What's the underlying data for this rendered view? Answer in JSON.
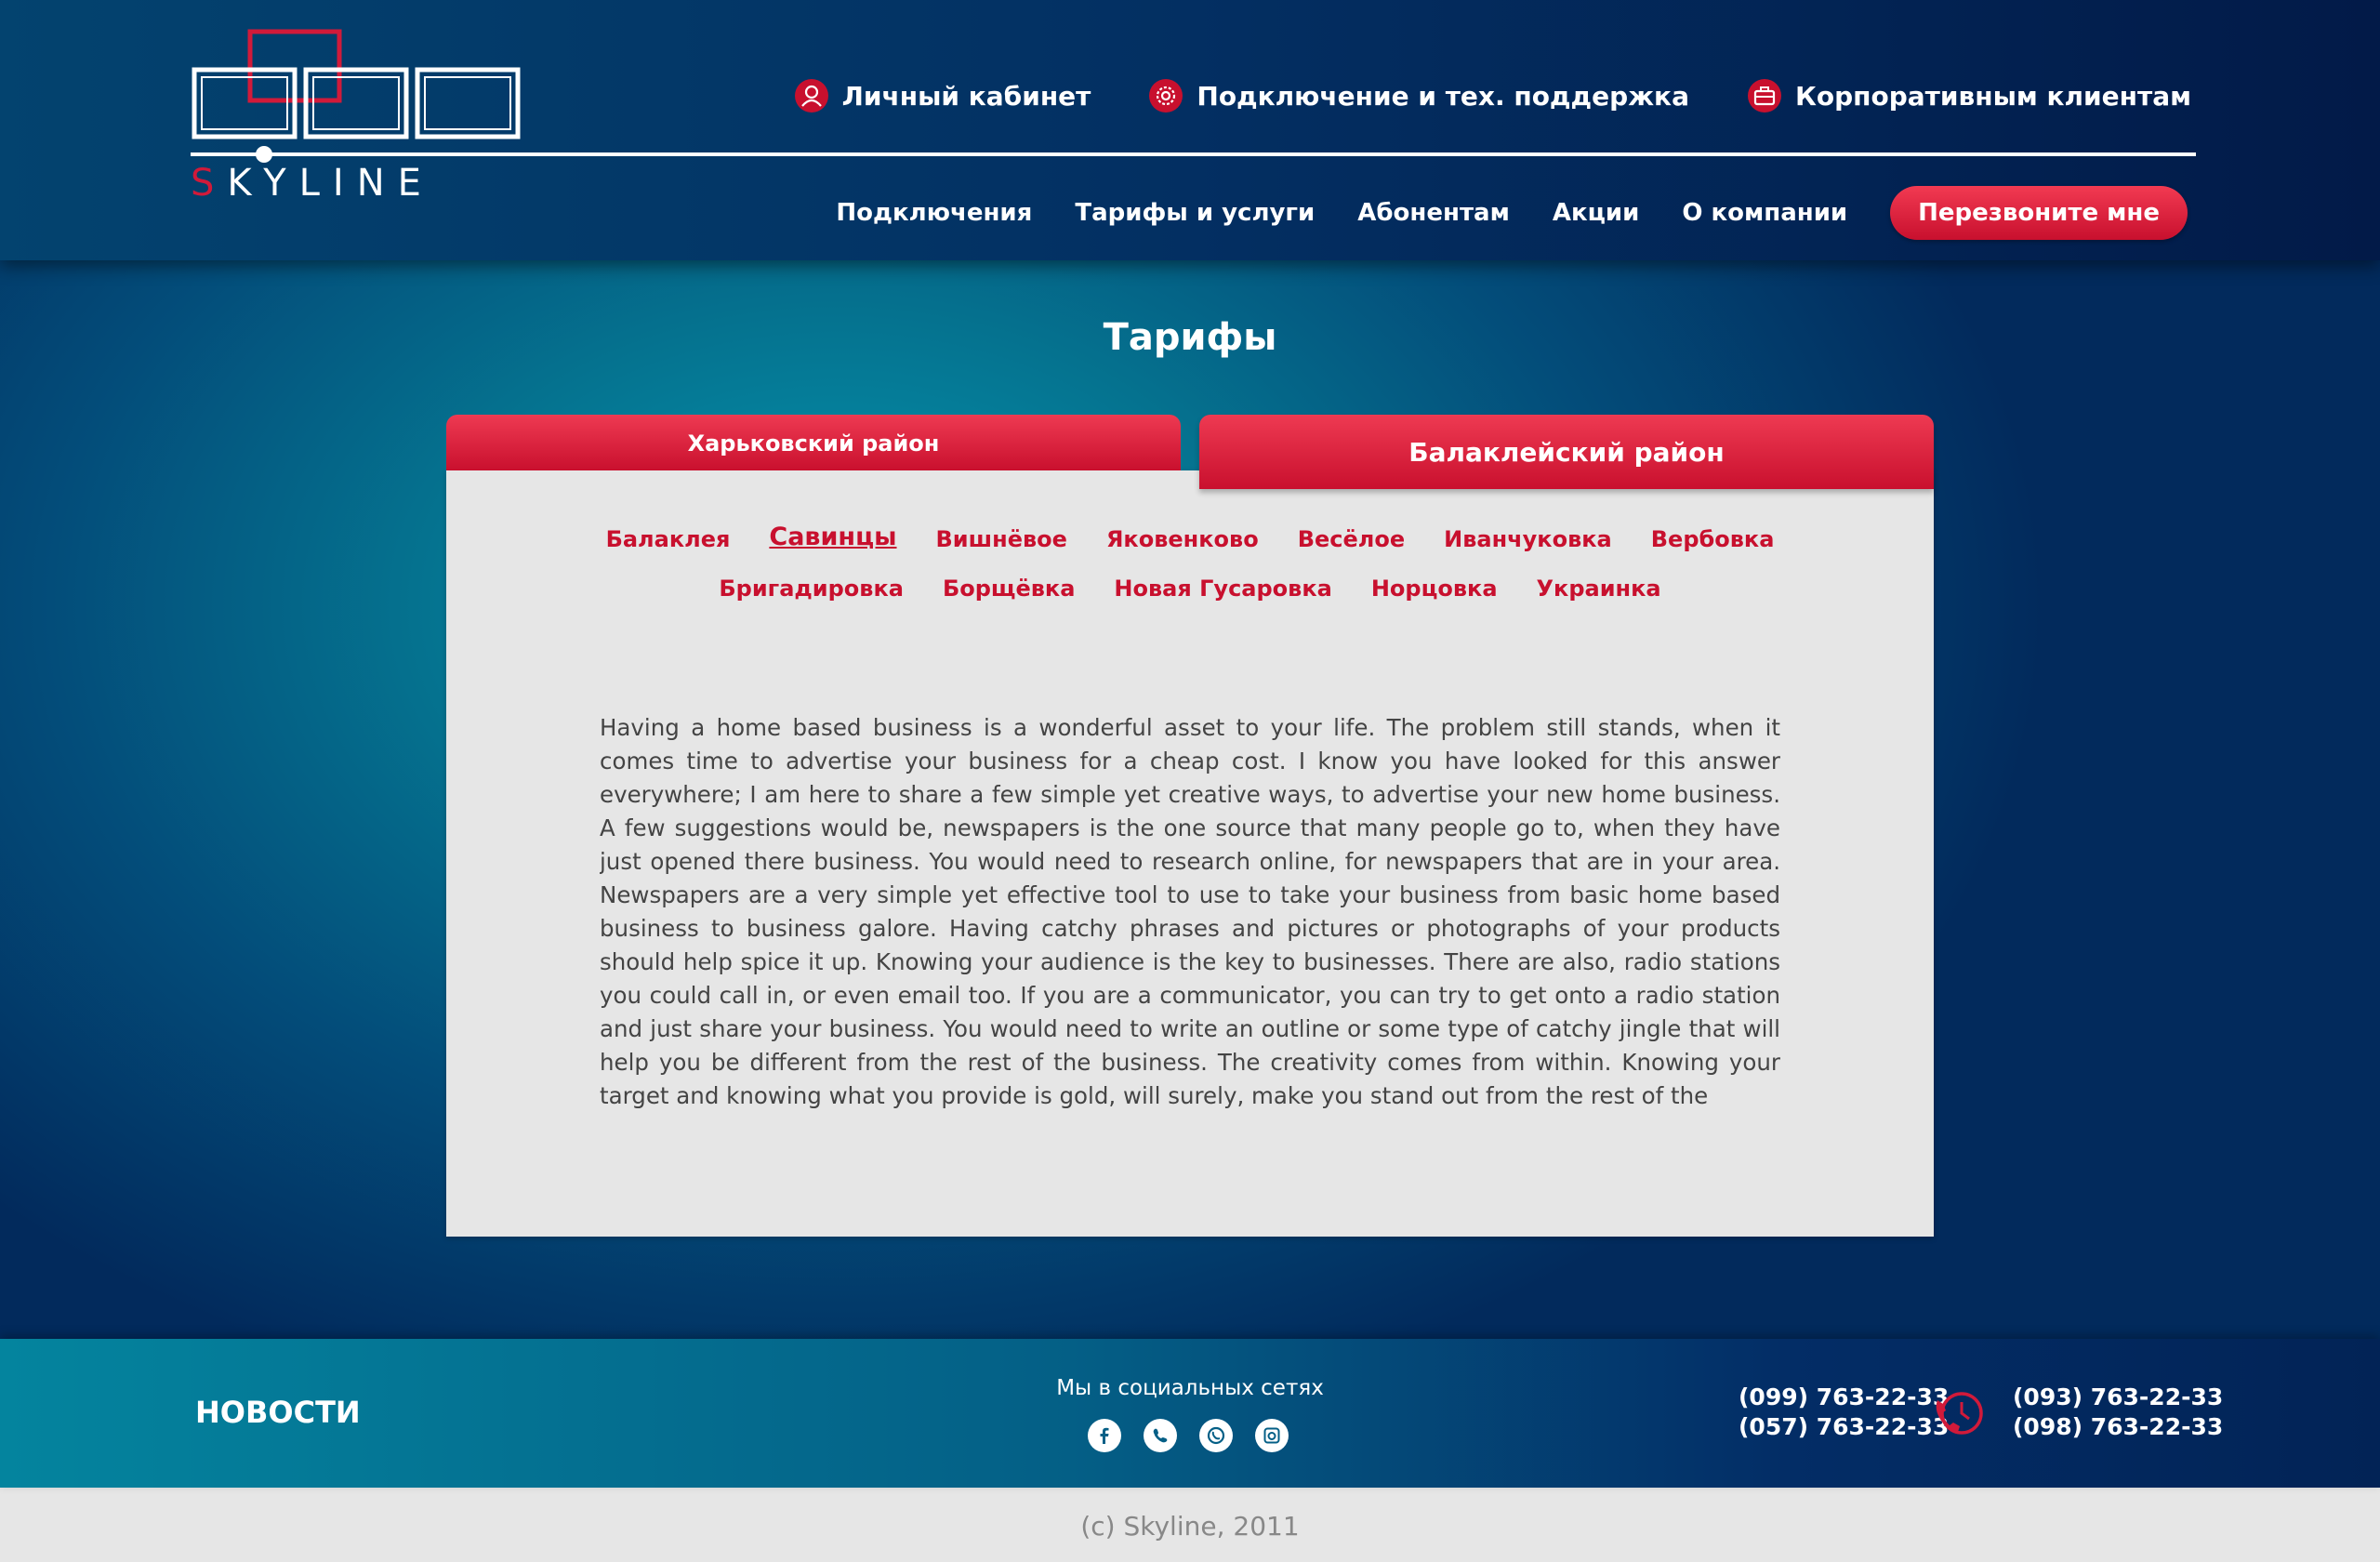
{
  "brand": {
    "name": "SKYLINE",
    "accent_color": "#c8102e"
  },
  "top_links": [
    {
      "label": "Личный кабинет",
      "icon": "user-icon"
    },
    {
      "label": "Подключение и тех. поддержка",
      "icon": "gear-icon"
    },
    {
      "label": "Корпоративным клиентам",
      "icon": "briefcase-icon"
    }
  ],
  "nav": {
    "items": [
      "Подключения",
      "Тарифы и услуги",
      "Абонентам",
      "Акции",
      "О компании"
    ],
    "callback_label": "Перезвоните мне"
  },
  "page_title": "Тарифы",
  "tabs": {
    "left": "Харьковский район",
    "right": "Балаклейский район",
    "active": "right"
  },
  "villages": {
    "row1": [
      "Балаклея",
      "Савинцы",
      "Вишнёвое",
      "Яковенково",
      "Весёлое",
      "Иванчуковка",
      "Вербовка"
    ],
    "row2": [
      "Бригадировка",
      "Борщёвка",
      "Новая Гусаровка",
      "Норцовка",
      "Украинка"
    ],
    "active": "Савинцы"
  },
  "body_text": "Having a home based business is a wonderful asset to your life. The problem still stands, when it comes time to advertise your business for a cheap cost. I know you have looked for this answer everywhere; I am here to share a few simple yet creative ways, to advertise your new home business. A few suggestions would be, newspapers is the one source that many people go to, when they have just opened there business. You would need to research online, for newspapers that are in your area. Newspapers are a very simple yet effective tool to use to take your business from basic home based business to business galore. Having catchy phrases and pictures or photographs of your products should help spice it up. Knowing your audience is the key to businesses. There are also, radio stations you could call in, or even email too. If you are a communicator, you can try to get onto a radio station and just share your business. You would need to write an outline or some type of catchy jingle that will help you be different from the rest of the business. The creativity comes from within. Knowing your target and knowing what you provide is gold, will surely, make you stand out from the rest of the",
  "footer": {
    "news_label": "НОВОСТИ",
    "social_title": "Мы в социальных сетях",
    "socials": [
      "facebook-icon",
      "viber-icon",
      "whatsapp-icon",
      "instagram-icon"
    ],
    "phones_left": [
      "(099) 763-22-33",
      "(057) 763-22-33"
    ],
    "phones_right": [
      "(093) 763-22-33",
      "(098) 763-22-33"
    ],
    "copyright": "(c) Skyline, 2011"
  }
}
